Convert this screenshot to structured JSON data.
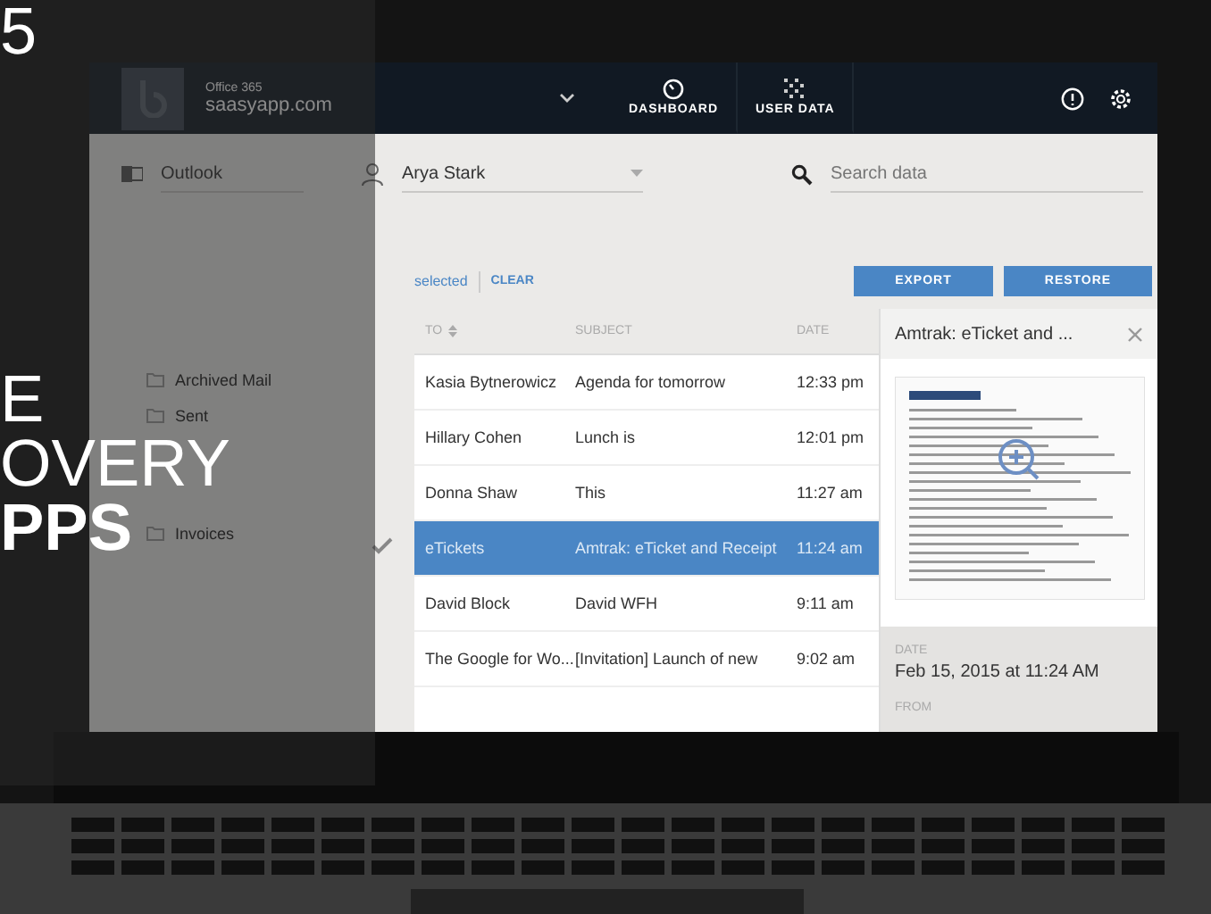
{
  "overlay": {
    "lines": [
      {
        "text": "5",
        "bold": false
      },
      {
        "text": "E",
        "bold": false
      },
      {
        "text": "OVERY",
        "bold": false
      },
      {
        "text": "PPS",
        "bold": true
      }
    ]
  },
  "top_bar": {
    "product": "Office 365",
    "domain": "saasyapp.com",
    "tabs": [
      {
        "label": "DASHBOARD",
        "selected": false
      },
      {
        "label": "USER DATA",
        "selected": false
      }
    ]
  },
  "filters": {
    "source": "Outlook",
    "user": "Arya Stark",
    "search": {
      "placeholder": "Search data"
    }
  },
  "folders": [
    "Archived Mail",
    "Sent",
    "Invoices"
  ],
  "selection": {
    "label": "selected",
    "clear": "CLEAR"
  },
  "actions": [
    "EXPORT",
    "RESTORE"
  ],
  "table": {
    "columns": [
      {
        "label": "TO",
        "sortable": true
      },
      {
        "label": "SUBJECT",
        "sortable": false
      },
      {
        "label": "DATE",
        "sortable": false
      }
    ],
    "rows": [
      {
        "to": "Kasia Bytnerowicz",
        "subject": "Agenda for tomorrow",
        "date": "12:33 pm",
        "selected": false
      },
      {
        "to": "Hillary Cohen",
        "subject": "Lunch is",
        "date": "12:01 pm",
        "selected": false
      },
      {
        "to": "Donna Shaw",
        "subject": "This",
        "date": "11:27 am",
        "selected": false
      },
      {
        "to": "eTickets",
        "subject": "Amtrak: eTicket and Receipt",
        "date": "11:24 am",
        "selected": true
      },
      {
        "to": "David Block",
        "subject": "David WFH",
        "date": "9:11 am",
        "selected": false
      },
      {
        "to": "The Google for Wo...",
        "subject": "[Invitation] Launch of new",
        "date": "9:02 am",
        "selected": false
      }
    ]
  },
  "preview": {
    "title": "Amtrak: eTicket and ...",
    "date_label": "DATE",
    "date": "Feb 15, 2015 at 11:24 AM",
    "from_label": "FROM"
  }
}
